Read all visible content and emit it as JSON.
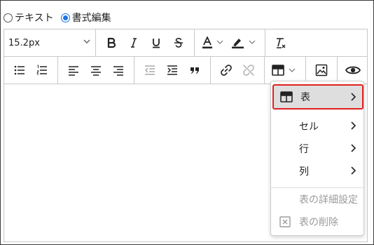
{
  "mode": {
    "options": [
      {
        "label": "テキスト",
        "checked": false
      },
      {
        "label": "書式編集",
        "checked": true
      }
    ]
  },
  "toolbar": {
    "font_size": "15.2px",
    "buttons_row1": [
      "bold-icon",
      "italic-icon",
      "underline-icon",
      "strikethrough-icon",
      "text-color-icon",
      "highlight-icon",
      "clear-format-icon"
    ],
    "buttons_row2": [
      "bulleted-list-icon",
      "numbered-list-icon",
      "align-left-icon",
      "align-center-icon",
      "align-right-icon",
      "outdent-icon",
      "indent-icon",
      "blockquote-icon",
      "link-icon",
      "unlink-icon",
      "table-icon",
      "image-icon",
      "preview-icon"
    ]
  },
  "table_menu": {
    "items": [
      {
        "label": "表",
        "icon": "table-icon",
        "submenu": true,
        "highlighted": true
      },
      {
        "label": "セル",
        "submenu": true
      },
      {
        "label": "行",
        "submenu": true
      },
      {
        "label": "列",
        "submenu": true
      },
      {
        "label": "表の詳細設定",
        "disabled": true
      },
      {
        "label": "表の削除",
        "icon": "delete-icon",
        "disabled": true
      }
    ]
  },
  "colors": {
    "accent": "#1a73e8",
    "highlight_border": "#e02020",
    "disabled_text": "#9b9b9b"
  }
}
